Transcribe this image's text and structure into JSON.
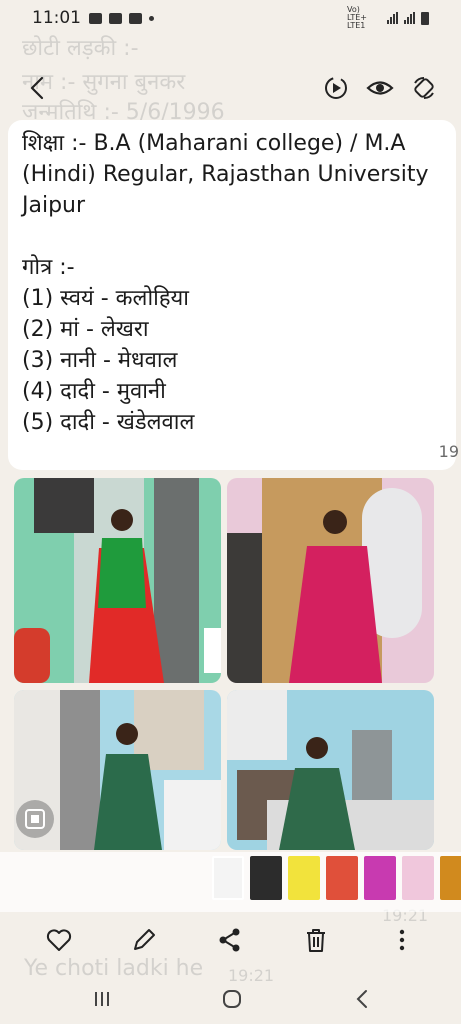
{
  "status": {
    "time": "11:01",
    "network": "Vo) LTE+ LTE1"
  },
  "ghost_text": {
    "line1": "छोटी लड़की :-",
    "line2": "नाम :- सुगना बुनकर",
    "line3": "जन्मतिथि :- 5/6/1996",
    "bottom_caption": "Ye choti ladki he",
    "bottom_time_1": "19:21",
    "bottom_time_2": "19:21"
  },
  "message": {
    "lines": [
      "शिक्षा :- B.A (Maharani college) / M.A",
      "(Hindi) Regular, Rajasthan University",
      "Jaipur",
      "",
      "गोत्र :-",
      "(1) स्वयं - कलोहिया",
      "(2) मां - लेखरा",
      "(3) नानी - मेधवाल",
      "(4) दादी - मुवानी",
      "(5) दादी - खंडेलवाल"
    ]
  },
  "page_counter": "19",
  "thumbnail_count": 7,
  "icons": {
    "back": "back-arrow-icon",
    "motion": "motion-photo-icon",
    "view": "eye-icon",
    "rotate": "rotate-icon",
    "like": "heart-icon",
    "edit": "pencil-icon",
    "share": "share-icon",
    "delete": "trash-icon",
    "more": "more-vertical-icon",
    "scan": "scan-icon"
  }
}
